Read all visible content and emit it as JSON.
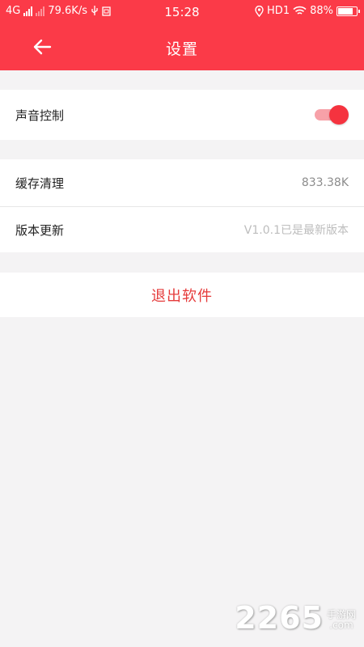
{
  "status_bar": {
    "network_type": "4G",
    "speed": "79.6K/s",
    "time": "15:28",
    "hd_label": "HD1",
    "battery_percent": "88%",
    "battery_level": 0.88
  },
  "header": {
    "title": "设置",
    "back_icon": "arrow-left-icon",
    "background_color": "#fb3a48"
  },
  "settings": {
    "sound": {
      "label": "声音控制",
      "enabled": true
    },
    "cache": {
      "label": "缓存清理",
      "value": "833.38K"
    },
    "version": {
      "label": "版本更新",
      "value": "V1.0.1已是最新版本"
    }
  },
  "logout": {
    "label": "退出软件",
    "color": "#e53b3b"
  },
  "watermark": {
    "brand": "2265",
    "sub_line1": "手游网",
    "sub_line2": ".com"
  }
}
